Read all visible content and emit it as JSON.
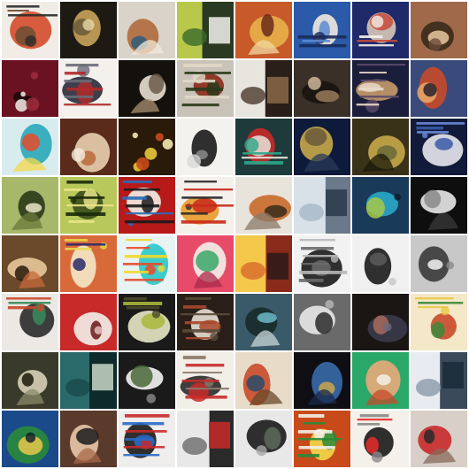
{
  "grid": {
    "rows": 8,
    "cols": 8,
    "tiles": [
      {
        "bg": "#f1ede6",
        "c1": "#d44b2a",
        "c2": "#6d4c32",
        "c3": "#2a2a2a",
        "style": "text-top"
      },
      {
        "bg": "#1d1913",
        "c1": "#c9a35a",
        "c2": "#6a5a3a",
        "c3": "#e8d8a8",
        "style": "blob"
      },
      {
        "bg": "#d9d3c9",
        "c1": "#b06a3c",
        "c2": "#2f5c7a",
        "c3": "#f0e8d8",
        "style": "figure"
      },
      {
        "bg": "#2a3a22",
        "c1": "#b9c84a",
        "c2": "#f4f2ee",
        "c3": "#3a6a2a",
        "style": "split"
      },
      {
        "bg": "#c85a2a",
        "c1": "#e8b04a",
        "c2": "#6a2a1a",
        "c3": "#f0d8a0",
        "style": "figure"
      },
      {
        "bg": "#2a5aa8",
        "c1": "#f0e8e0",
        "c2": "#5a8ad0",
        "c3": "#1a2a5a",
        "style": "text-bottom"
      },
      {
        "bg": "#1e2a6a",
        "c1": "#d8c8b8",
        "c2": "#c84a3a",
        "c3": "#f4f0ea",
        "style": "text-bottom"
      },
      {
        "bg": "#a06a4a",
        "c1": "#3a2a1a",
        "c2": "#e8c8a0",
        "c3": "#6a4a3a",
        "style": "blob"
      },
      {
        "bg": "#6a1222",
        "c1": "#1a0a0a",
        "c2": "#e8e0d8",
        "c3": "#9a2a3a",
        "style": "dots"
      },
      {
        "bg": "#f4f0ec",
        "c1": "#2a2a3a",
        "c2": "#b02a2a",
        "c3": "#6a6a7a",
        "style": "text-lines"
      },
      {
        "bg": "#14100c",
        "c1": "#e8e0d0",
        "c2": "#6a5a4a",
        "c3": "#a89070",
        "style": "figure"
      },
      {
        "bg": "#c8c2b8",
        "c1": "#8a2a1a",
        "c2": "#2a3a1a",
        "c3": "#e0d8c8",
        "style": "text-lines"
      },
      {
        "bg": "#2a1e18",
        "c1": "#e8e4de",
        "c2": "#8a6a4a",
        "c3": "#4a3a2a",
        "style": "split"
      },
      {
        "bg": "#3a3028",
        "c1": "#1a1410",
        "c2": "#9a7a5a",
        "c3": "#d8c0a0",
        "style": "blob"
      },
      {
        "bg": "#1a1e3a",
        "c1": "#c89a6a",
        "c2": "#e8d8c8",
        "c3": "#5a4a6a",
        "style": "text-lines"
      },
      {
        "bg": "#3a4a7a",
        "c1": "#c84a2a",
        "c2": "#e8a86a",
        "c3": "#1a1a2a",
        "style": "blob"
      },
      {
        "bg": "#d8ecf0",
        "c1": "#2aa8b8",
        "c2": "#e84a2a",
        "c3": "#f4d84a",
        "style": "figure"
      },
      {
        "bg": "#5a2a1a",
        "c1": "#e8d0b0",
        "c2": "#b86a3a",
        "c3": "#f4ece0",
        "style": "blob"
      },
      {
        "bg": "#2a1a0a",
        "c1": "#e8c83a",
        "c2": "#c84a1a",
        "c3": "#f4e8b0",
        "style": "dots"
      },
      {
        "bg": "#f4f2ee",
        "c1": "#1a1a1a",
        "c2": "#8a8a8a",
        "c3": "#d8d8d8",
        "style": "blob"
      },
      {
        "bg": "#1e3a3a",
        "c1": "#c82a2a",
        "c2": "#e8e4dc",
        "c3": "#2aa88a",
        "style": "text-bottom"
      },
      {
        "bg": "#0e1a3a",
        "c1": "#c8a84a",
        "c2": "#6a5a3a",
        "c3": "#2a3a5a",
        "style": "figure"
      },
      {
        "bg": "#3a3218",
        "c1": "#c8a84a",
        "c2": "#6a6a3a",
        "c3": "#1a1a0a",
        "style": "figure"
      },
      {
        "bg": "#121a3a",
        "c1": "#e8e8f0",
        "c2": "#3a5aa8",
        "c3": "#6a8ad8",
        "style": "text-top"
      },
      {
        "bg": "#a8b86a",
        "c1": "#2a3a1a",
        "c2": "#e8e8c8",
        "c3": "#6a7a3a",
        "style": "figure"
      },
      {
        "bg": "#b8c85a",
        "c1": "#3a4a1a",
        "c2": "#e8e48a",
        "c3": "#1a2a0a",
        "style": "text-lines"
      },
      {
        "bg": "#b81a1a",
        "c1": "#f4f0e8",
        "c2": "#1a1a1a",
        "c3": "#2a6ab8",
        "style": "text-lines"
      },
      {
        "bg": "#f4f0ea",
        "c1": "#e89a2a",
        "c2": "#c82a1a",
        "c3": "#2a2a2a",
        "style": "text-lines"
      },
      {
        "bg": "#e8e4dc",
        "c1": "#c86a2a",
        "c2": "#3a2a1a",
        "c3": "#8a7a6a",
        "style": "figure"
      },
      {
        "bg": "#6a7a8a",
        "c1": "#d8e0e8",
        "c2": "#2a3a4a",
        "c3": "#a8b8c8",
        "style": "split"
      },
      {
        "bg": "#1a3a5a",
        "c1": "#2aa8c8",
        "c2": "#a8c84a",
        "c3": "#0a1a2a",
        "style": "blob"
      },
      {
        "bg": "#0e0e0e",
        "c1": "#e8e8e8",
        "c2": "#8a8a8a",
        "c3": "#3a3a3a",
        "style": "figure"
      },
      {
        "bg": "#6a4a2a",
        "c1": "#e8c89a",
        "c2": "#2a1a0a",
        "c3": "#c86a3a",
        "style": "figure"
      },
      {
        "bg": "#d86a3a",
        "c1": "#f4e8c8",
        "c2": "#2a2a6a",
        "c3": "#e8d84a",
        "style": "text-top"
      },
      {
        "bg": "#e8f4f4",
        "c1": "#2ac8c8",
        "c2": "#e84a2a",
        "c3": "#f4d82a",
        "style": "text-lines"
      },
      {
        "bg": "#e84a6a",
        "c1": "#f4f0e8",
        "c2": "#3aa86a",
        "c3": "#a82a4a",
        "style": "figure"
      },
      {
        "bg": "#8a2a1a",
        "c1": "#f4c84a",
        "c2": "#2a1a1a",
        "c3": "#d86a2a",
        "style": "split"
      },
      {
        "bg": "#f2f2f2",
        "c1": "#1a1a1a",
        "c2": "#6a6a6a",
        "c3": "#b8b8b8",
        "style": "text-lines"
      },
      {
        "bg": "#f0f0f0",
        "c1": "#1a1a1a",
        "c2": "#5a5a5a",
        "c3": "#c8c8c8",
        "style": "blob"
      },
      {
        "bg": "#c8c8c8",
        "c1": "#3a3a3a",
        "c2": "#f4f4f4",
        "c3": "#8a8a8a",
        "style": "blob"
      },
      {
        "bg": "#ece8e4",
        "c1": "#2a2a2a",
        "c2": "#3a8a5a",
        "c3": "#c84a2a",
        "style": "text-top"
      },
      {
        "bg": "#c82a2a",
        "c1": "#f4f0ea",
        "c2": "#6a1a1a",
        "c3": "#e8c8c8",
        "style": "blob"
      },
      {
        "bg": "#1a1a1a",
        "c1": "#e8e8c8",
        "c2": "#a8b83a",
        "c3": "#4a4a2a",
        "style": "text-top"
      },
      {
        "bg": "#2a1e18",
        "c1": "#e8e0d4",
        "c2": "#a8482a",
        "c3": "#5a4a3a",
        "style": "text-lines"
      },
      {
        "bg": "#3a5a6a",
        "c1": "#1a2a2a",
        "c2": "#6ab8c8",
        "c3": "#c8d8d8",
        "style": "figure"
      },
      {
        "bg": "#6a6a6a",
        "c1": "#e8e8e8",
        "c2": "#2a2a2a",
        "c3": "#b8b8b8",
        "style": "blob"
      },
      {
        "bg": "#1a1614",
        "c1": "#3a3a4a",
        "c2": "#a86a5a",
        "c3": "#6a6a7a",
        "style": "blob"
      },
      {
        "bg": "#f4e8c8",
        "c1": "#c84a2a",
        "c2": "#3a8a3a",
        "c3": "#e8c84a",
        "style": "text-top"
      },
      {
        "bg": "#3a3a2a",
        "c1": "#d8d0b8",
        "c2": "#1a1a0a",
        "c3": "#8a8a6a",
        "style": "figure"
      },
      {
        "bg": "#0e2a2a",
        "c1": "#2a6a6a",
        "c2": "#c8d8c8",
        "c3": "#1a4a4a",
        "style": "split"
      },
      {
        "bg": "#1a1a1a",
        "c1": "#f4f4f4",
        "c2": "#4a6a3a",
        "c3": "#8a8a8a",
        "style": "blob"
      },
      {
        "bg": "#f2eee8",
        "c1": "#2a2a2a",
        "c2": "#c82a2a",
        "c3": "#8a7a6a",
        "style": "text-lines"
      },
      {
        "bg": "#e8dcc8",
        "c1": "#c84a2a",
        "c2": "#2a4a6a",
        "c3": "#6a4a2a",
        "style": "figure"
      },
      {
        "bg": "#0e0e14",
        "c1": "#3a6aa8",
        "c2": "#c8a84a",
        "c3": "#1a2a4a",
        "style": "figure"
      },
      {
        "bg": "#2aa86a",
        "c1": "#e8a87a",
        "c2": "#f4f0e8",
        "c3": "#c84a2a",
        "style": "figure"
      },
      {
        "bg": "#3a4a5a",
        "c1": "#e8ecf0",
        "c2": "#1a2a3a",
        "c3": "#8a9aaa",
        "style": "split"
      },
      {
        "bg": "#1a4a8a",
        "c1": "#2a8a3a",
        "c2": "#e8c84a",
        "c3": "#0a1a2a",
        "style": "blob"
      },
      {
        "bg": "#5a3a2a",
        "c1": "#e8c8a8",
        "c2": "#1a1a1a",
        "c3": "#a86a4a",
        "style": "figure"
      },
      {
        "bg": "#f0eeec",
        "c1": "#1a1a1a",
        "c2": "#2a6ac8",
        "c3": "#c82a2a",
        "style": "text-lines"
      },
      {
        "bg": "#2a2a2a",
        "c1": "#e8e8e8",
        "c2": "#c82a2a",
        "c3": "#6a6a6a",
        "style": "split"
      },
      {
        "bg": "#e8e8e8",
        "c1": "#1a1a1a",
        "c2": "#5a6a5a",
        "c3": "#a8a8a8",
        "style": "blob"
      },
      {
        "bg": "#c84a1a",
        "c1": "#f4d84a",
        "c2": "#2a8a3a",
        "c3": "#f4f0e8",
        "style": "text-lines"
      },
      {
        "bg": "#f4f0ea",
        "c1": "#1a1a1a",
        "c2": "#e82a2a",
        "c3": "#8a8a8a",
        "style": "text-top"
      },
      {
        "bg": "#d8d0c8",
        "c1": "#c82a2a",
        "c2": "#2a2a2a",
        "c3": "#8a6a5a",
        "style": "figure"
      }
    ]
  }
}
